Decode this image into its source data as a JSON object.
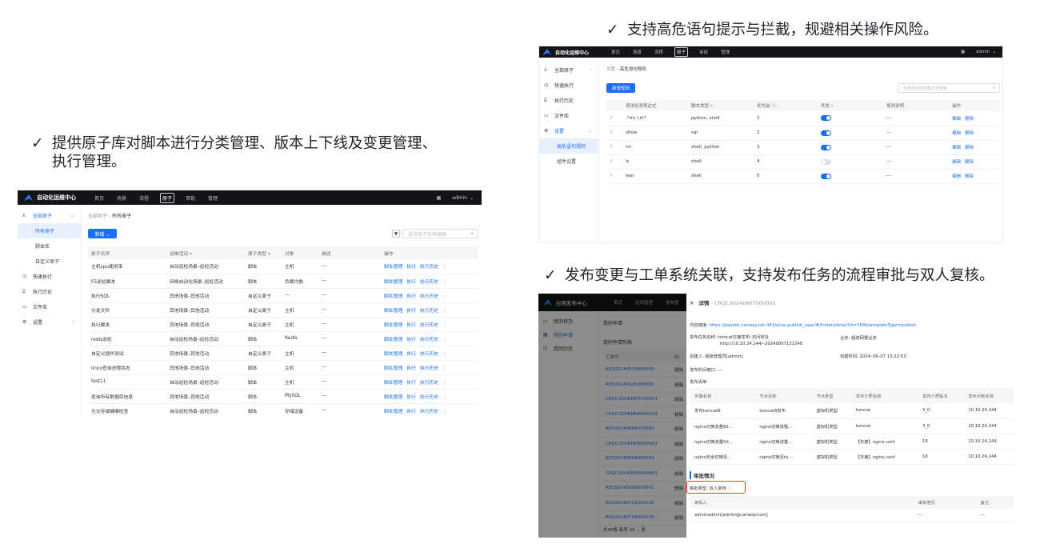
{
  "captions": {
    "left": [
      "提供原子库对脚本进行分类管理、版本上下线及变更管理、",
      "执行管理。"
    ],
    "top_right": "支持高危语句提示与拦截，规避相关操作风险。",
    "bottom_right": "发布变更与工单系统关联，支持发布任务的流程审批与双人复核。",
    "check": "✓"
  },
  "app": {
    "logo": "自动化运维中心",
    "menu": [
      "首页",
      "场景",
      "流程",
      "原子",
      "审批",
      "管理"
    ],
    "active_menu": "原子",
    "user": "admin",
    "user_arrow": "⌄"
  },
  "left_shot": {
    "sidebar": [
      {
        "label": "全部原子",
        "icon": "⅄",
        "arrow": "⌄",
        "cls": "act"
      },
      {
        "label": "所有原子",
        "cls": "sub subact"
      },
      {
        "label": "脚本库",
        "cls": "sub"
      },
      {
        "label": "自定义原子",
        "cls": "sub"
      },
      {
        "label": "快速执行",
        "icon": "◷"
      },
      {
        "label": "执行历史",
        "icon": "⌸"
      },
      {
        "label": "文件库",
        "icon": "▭"
      },
      {
        "label": "设置",
        "icon": "⚙",
        "arrow": "›"
      }
    ],
    "breadcrumb": [
      "全部原子",
      "所有原子"
    ],
    "add_button": "新增 ⌄",
    "search_placeholder": "支持原子名称搜索",
    "columns": [
      "原子名称",
      "运维活动 ▿",
      "原子类型 ▿",
      "对象",
      "描述",
      "操作"
    ],
    "rows": [
      [
        "主机cpu使用率",
        "自动巡检场景–巡检活动",
        "脚本",
        "主机",
        "---"
      ],
      [
        "F5巡检脚本",
        "网络自动化场景–巡检活动",
        "脚本",
        "负载均衡",
        "---"
      ],
      [
        "执行SQL",
        "其他场景–其他活动",
        "自定义原子",
        "---",
        "---"
      ],
      [
        "分发文件",
        "其他场景–其他活动",
        "自定义原子",
        "主机",
        "---"
      ],
      [
        "执行脚本",
        "其他场景–其他活动",
        "自定义原子",
        "主机",
        "---"
      ],
      [
        "redis巡检",
        "自动巡检场景–巡检活动",
        "脚本",
        "Redis",
        "---"
      ],
      [
        "自定义插件测试",
        "其他场景–其他活动",
        "自定义原子",
        "主机",
        "---"
      ],
      [
        "linux查询进程状态",
        "其他场景–其他活动",
        "脚本",
        "主机",
        "---"
      ],
      [
        "test11",
        "自动巡检场景–巡检活动",
        "脚本",
        "主机",
        "---"
      ],
      [
        "查询所有数据库信息",
        "其他场景–其他活动",
        "脚本",
        "MySQL",
        "---"
      ],
      [
        "光交存储健康检查",
        "自动巡检场景–巡检活动",
        "脚本",
        "存储设备",
        "---"
      ]
    ],
    "row_actions": [
      "脚本管理",
      "执行",
      "执行历史",
      "⋮"
    ]
  },
  "tr_shot": {
    "sidebar": [
      {
        "label": "全部原子",
        "icon": "⅄",
        "arrow": "›"
      },
      {
        "label": "快速执行",
        "icon": "◷"
      },
      {
        "label": "执行历史",
        "icon": "⌸"
      },
      {
        "label": "文件库",
        "icon": "▭"
      },
      {
        "label": "设置",
        "icon": "⚙",
        "arrow": "⌄",
        "cls": "act"
      },
      {
        "label": "高危语句规则",
        "cls": "sub subact"
      },
      {
        "label": "组件设置",
        "cls": "sub"
      }
    ],
    "breadcrumb": [
      "设置",
      "高危语句规则"
    ],
    "add_button": "新增规则",
    "search_placeholder": "支持通过检测表达式搜索",
    "columns": [
      "",
      "语法检测表达式",
      "脚本类型 ▿",
      "优先级 ⓘ",
      "状态 ▿",
      "规则说明",
      "操作"
    ],
    "rows": [
      {
        "expr": ".*rm \\-rf.*",
        "type": "python, shell",
        "pri": "1",
        "on": true,
        "desc": "---"
      },
      {
        "expr": "show",
        "type": "sql",
        "pri": "2",
        "on": true,
        "desc": "---"
      },
      {
        "expr": "rm",
        "type": "shell, python",
        "pri": "3",
        "on": true,
        "desc": "---"
      },
      {
        "expr": "ls",
        "type": "shell",
        "pri": "4",
        "on": false,
        "desc": "---"
      },
      {
        "expr": "test",
        "type": "shell",
        "pri": "5",
        "on": true,
        "desc": "---"
      }
    ],
    "drag": "⠿",
    "row_actions": [
      "编辑",
      "删除"
    ]
  },
  "br_shot": {
    "logo": "应用发布中心",
    "menu": [
      "首页",
      "应用管理",
      "发布管"
    ],
    "sidebar": [
      {
        "label": "我的待办",
        "icon": "▭"
      },
      {
        "label": "我的申请",
        "icon": "▤",
        "cls": "act"
      },
      {
        "label": "我的历史",
        "icon": "◷"
      }
    ],
    "page_title": "我的申请",
    "list_title": "我的申请列表",
    "list_header": [
      "工单号",
      "标"
    ],
    "tickets": [
      [
        "REQ20240925000000",
        "超级"
      ],
      [
        "REQ20240925000000",
        "超级"
      ],
      [
        "CRQC20240807000001",
        "超级"
      ],
      [
        "CRQC20240806000003",
        "超级"
      ],
      [
        "REQ20240806000003",
        "超级"
      ],
      [
        "CRQC20240806000002",
        "超级"
      ],
      [
        "REQ20240806000003",
        "超级"
      ],
      [
        "CRQC20240806000001",
        "超级"
      ],
      [
        "REQ20240806000001",
        "超级"
      ],
      [
        "REQ20240723000126",
        "超级"
      ],
      [
        "REQ20240709000135",
        "超级"
      ]
    ],
    "footer": "共40条  每页  20 ⌄  条",
    "detail": {
      "title": "详情",
      "ticket_id": "CRQC20240807000001",
      "close": "✕",
      "link_label": "内容链接:",
      "link": "https://paasbk.canway.net:443/o/cw-publish_saas/#/historydetail?id=568&templateType=publish",
      "task_label": "发布任务名称:",
      "task": "tomcat灰度发布–访问地址",
      "task2": "http://10.10.24.144/–20240807132246",
      "biz_label": "业务:",
      "biz": "超级网银业务",
      "creator_label": "创建人:",
      "creator": "超级管理员[admin]",
      "ctime_label": "创建时间:",
      "ctime": "2024–08–07 13:22:53",
      "window_label": "发布时间窗口:",
      "window": "---",
      "list_label": "发布清单:",
      "columns": [
        "步骤名称",
        "节点名称",
        "节点类型",
        "发布介质名称",
        "发布介质版本",
        "发布对象名称"
      ],
      "rows": [
        [
          "发布tomcat8",
          "tomcat8发布",
          "虚拟机类型",
          "tomcat",
          "3_0",
          "10.10.24.144"
        ],
        [
          "nginx切换流量80...",
          "nginx切换流程...",
          "虚拟机类型",
          "tomcat",
          "3_0",
          "10.10.24.144"
        ],
        [
          "nginx切换流量50...",
          "nginx切换流量...",
          "虚拟机类型",
          "【灰度】nginx.conf",
          "18",
          "10.10.24.144"
        ],
        [
          "nginx完全切换至...",
          "nginx切换至to...",
          "虚拟机类型",
          "【灰度】nginx.conf",
          "18",
          "10.10.24.144"
        ]
      ],
      "approve_title": "审批情况",
      "approve_type_label": "审批类型:",
      "approve_type": "双人复核",
      "approve_cols": [
        "审批人",
        "审批意见",
        "备注"
      ],
      "approve_rows": [
        [
          "adminadmin[admin@canway.com]",
          "---",
          "---"
        ]
      ]
    }
  },
  "colors": {
    "accent": "#1a6ef2",
    "topbar": "#121418",
    "highlight": "#e0422d"
  }
}
